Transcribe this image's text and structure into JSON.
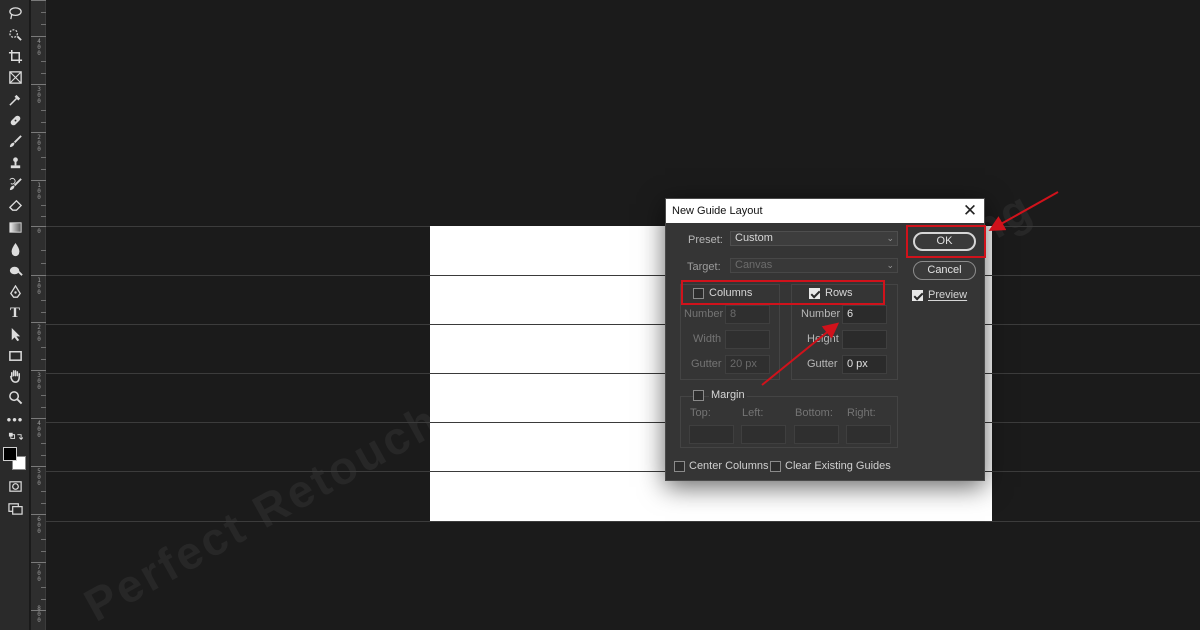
{
  "watermark": "Perfect Retouching",
  "ruler": {
    "labels": [
      "4\n0\n0",
      "3\n0\n0",
      "2\n0\n0",
      "1\n0\n0",
      "0",
      "1\n0\n0",
      "2\n0\n0",
      "3\n0\n0",
      "4\n0\n0",
      "5\n0\n0",
      "6\n0\n0",
      "7\n0\n0",
      "8\n0\n0"
    ]
  },
  "toolbar": {
    "tools": [
      "lasso-icon",
      "quick-selection-icon",
      "crop-icon",
      "frame-icon",
      "eyedropper-icon",
      "healing-brush-icon",
      "brush-icon",
      "clone-stamp-icon",
      "history-brush-icon",
      "eraser-icon",
      "gradient-icon",
      "blur-icon",
      "dodge-icon",
      "pen-icon",
      "type-icon",
      "path-selection-icon",
      "rectangle-icon",
      "hand-icon",
      "zoom-icon",
      "more-tools-icon",
      "swap-colors-icon",
      "color-swatches-icon",
      "quick-mask-icon",
      "screen-mode-icon"
    ],
    "type_glyph": "T",
    "more_glyph": "•••"
  },
  "dialog": {
    "title": "New Guide Layout",
    "close": "✕",
    "preset_label": "Preset:",
    "preset_value": "Custom",
    "target_label": "Target:",
    "target_value": "Canvas",
    "columns": {
      "label": "Columns",
      "checked": false,
      "number_label": "Number",
      "number_value": "8",
      "width_label": "Width",
      "width_value": "",
      "gutter_label": "Gutter",
      "gutter_value": "20 px"
    },
    "rows": {
      "label": "Rows",
      "checked": true,
      "number_label": "Number",
      "number_value": "6",
      "height_label": "Height",
      "height_value": "",
      "gutter_label": "Gutter",
      "gutter_value": "0 px"
    },
    "margin": {
      "label": "Margin",
      "checked": false,
      "top": "Top:",
      "left": "Left:",
      "bottom": "Bottom:",
      "right": "Right:"
    },
    "center_columns": {
      "label": "Center Columns",
      "checked": false
    },
    "clear_guides": {
      "label": "Clear Existing Guides",
      "checked": false
    },
    "ok": "OK",
    "cancel": "Cancel",
    "preview": {
      "label": "Preview",
      "checked": true
    }
  },
  "colors": {
    "highlight": "#d0121b",
    "canvas": "#ffffff",
    "workspace": "#1b1b1b",
    "dialog": "#353535"
  }
}
